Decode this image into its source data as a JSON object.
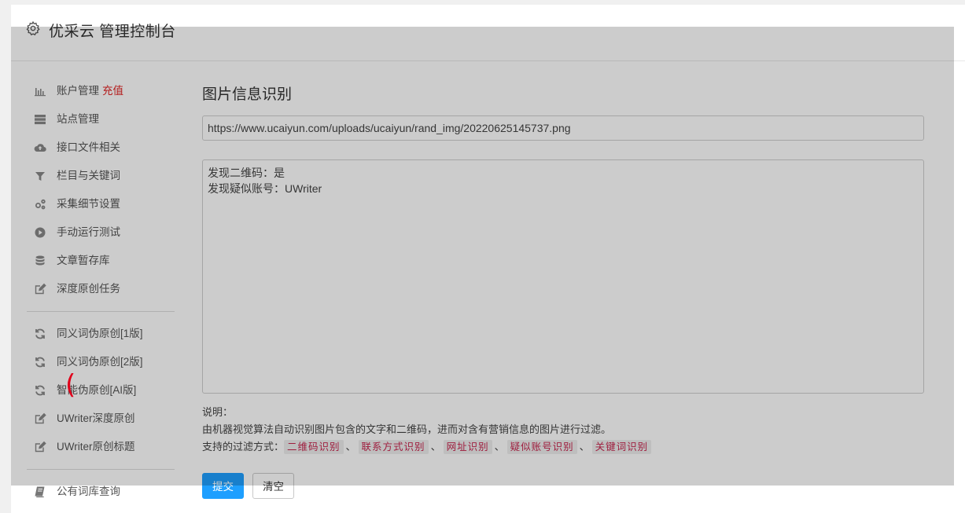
{
  "header": {
    "title": "优采云 管理控制台"
  },
  "sidebar": {
    "group1": [
      {
        "label": "账户管理",
        "badge": "充值",
        "icon": "bar-chart-icon"
      },
      {
        "label": "站点管理",
        "icon": "server-icon"
      },
      {
        "label": "接口文件相关",
        "icon": "cloud-upload-icon"
      },
      {
        "label": "栏目与关键词",
        "icon": "filter-icon"
      },
      {
        "label": "采集细节设置",
        "icon": "cogs-icon"
      },
      {
        "label": "手动运行测试",
        "icon": "play-circle-icon"
      },
      {
        "label": "文章暂存库",
        "icon": "database-icon"
      },
      {
        "label": "深度原创任务",
        "icon": "edit-icon"
      }
    ],
    "group2": [
      {
        "label": "同义词伪原创[1版]",
        "icon": "refresh-icon"
      },
      {
        "label": "同义词伪原创[2版]",
        "icon": "refresh-icon"
      },
      {
        "label": "智能伪原创[AI版]",
        "icon": "refresh-icon"
      },
      {
        "label": "UWriter深度原创",
        "icon": "edit-icon"
      },
      {
        "label": "UWriter原创标题",
        "icon": "edit-icon"
      }
    ],
    "group3": [
      {
        "label": "公有词库查询",
        "icon": "book-icon"
      }
    ]
  },
  "main": {
    "title": "图片信息识别",
    "url_value": "https://www.ucaiyun.com/uploads/ucaiyun/rand_img/20220625145737.png",
    "result_lines": [
      "发现二维码：是",
      "发现疑似账号：UWriter"
    ],
    "notes": {
      "heading": "说明：",
      "description": "由机器视觉算法自动识别图片包含的文字和二维码，进而对含有营销信息的图片进行过滤。",
      "filter_prefix": "支持的过滤方式：",
      "filter_tags": [
        "二维码识别",
        "联系方式识别",
        "网址识别",
        "疑似账号识别",
        "关键词识别"
      ],
      "separator": "、"
    },
    "buttons": {
      "submit": "提交",
      "clear": "清空"
    }
  },
  "annotation": {
    "mark": "("
  },
  "colors": {
    "primary": "#1e9fff",
    "recharge": "#e02424",
    "tag_text": "#c7254e",
    "annotation": "#e0001a"
  }
}
